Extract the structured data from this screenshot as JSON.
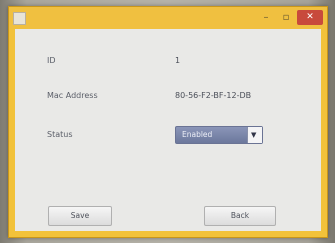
{
  "window": {
    "minimize_glyph": "–",
    "maximize_glyph": "▫",
    "close_glyph": "✕"
  },
  "form": {
    "id_label": "ID",
    "id_value": "1",
    "mac_label": "Mac Address",
    "mac_value": "80-56-F2-BF-12-DB",
    "status_label": "Status",
    "status_value": "Enabled",
    "dropdown_glyph": "▼"
  },
  "buttons": {
    "save_label": "Save",
    "back_label": "Back"
  }
}
